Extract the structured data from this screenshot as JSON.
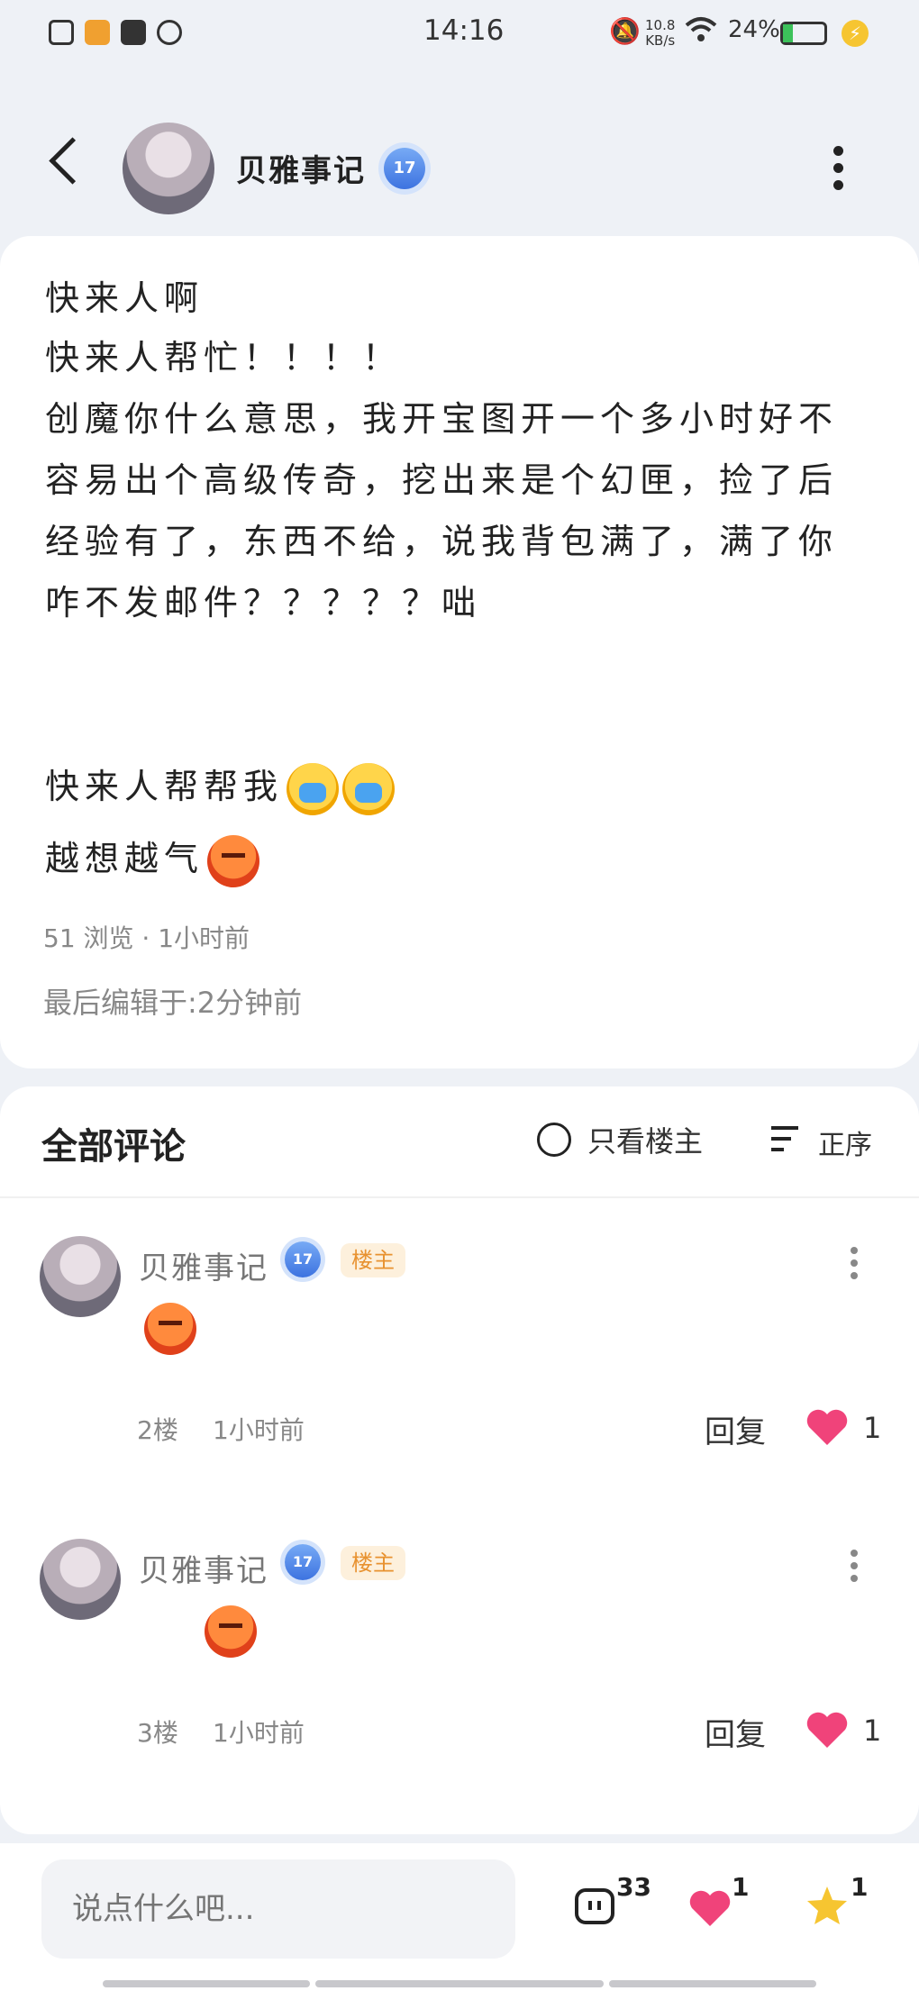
{
  "status_bar": {
    "time": "14:16",
    "net_speed": "10.8",
    "net_unit": "KB/s",
    "battery": "24%"
  },
  "header": {
    "author": "贝雅事记",
    "level": "17"
  },
  "post": {
    "lines": [
      "快来人啊",
      "快来人帮忙！！！！",
      "创魔你什么意思，我开宝图开一个多小时好不",
      "容易出个高级传奇，挖出来是个幻匣，捡了后",
      "经验有了，东西不给，说我背包满了，满了你",
      "咋不发邮件？？？？？咄",
      "快来人帮帮我",
      "越想越气"
    ],
    "views": "51 浏览 · 1小时前",
    "edited": "最后编辑于:2分钟前"
  },
  "comments_section": {
    "title": "全部评论",
    "only_op": "只看楼主",
    "sort": "正序",
    "comments": [
      {
        "name": "贝雅事记",
        "level": "17",
        "badge": "楼主",
        "floor": "2楼",
        "time": "1小时前",
        "reply": "回复",
        "likes": "1"
      },
      {
        "name": "贝雅事记",
        "level": "17",
        "badge": "楼主",
        "floor": "3楼",
        "time": "1小时前",
        "reply": "回复",
        "likes": "1"
      }
    ]
  },
  "bottom_bar": {
    "placeholder": "说点什么吧...",
    "comment_count": "33",
    "like_count": "1",
    "star_count": "1"
  },
  "colors": {
    "heart": "#f0437a",
    "star": "#f6c531",
    "level_badge": "#3d73e0",
    "op_badge_text": "#e89230"
  }
}
